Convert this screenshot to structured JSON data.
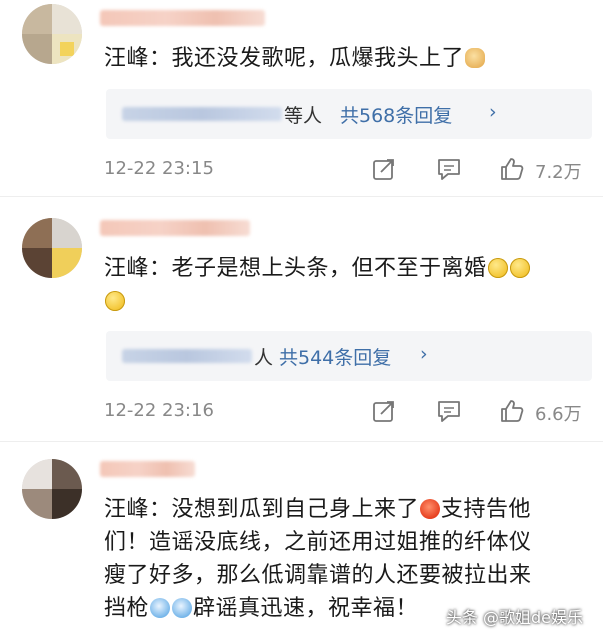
{
  "comments": [
    {
      "author": "汪峰",
      "text_before_emoji": "汪峰：我还没发歌呢，瓜爆我头上了",
      "emoji": "dog-emoji",
      "reply_suffix": "等人",
      "reply_count": "共568条回复",
      "timestamp": "12-22 23:15",
      "likes": "7.2万"
    },
    {
      "author": "汪峰",
      "text_before_emoji": "汪峰：老子是想上头条，但不至于离婚",
      "emoji": "smile-emoji",
      "reply_suffix": "人",
      "reply_count": "共544条回复",
      "timestamp": "12-22 23:16",
      "likes": "6.6万"
    },
    {
      "author": "汪峰",
      "line1": "汪峰：没想到瓜到自己身上来了",
      "line1_tail": "支持告他",
      "line2": "们！造谣没底线，之前还用过姐推的纤体仪",
      "line3": "瘦了好多，那么低调靠谱的人还要被拉出来",
      "line4_head": "挡枪",
      "line4_tail": "辟谣真迅速，祝幸福！"
    }
  ],
  "reply_chevron": "›",
  "watermark": "头条 @歌姐de娱乐",
  "colors": {
    "link_blue": "#3f6fa8",
    "meta_gray": "#888888",
    "reply_bg": "#f4f5f7"
  },
  "icons": [
    "share-icon",
    "comment-icon",
    "like-icon"
  ]
}
